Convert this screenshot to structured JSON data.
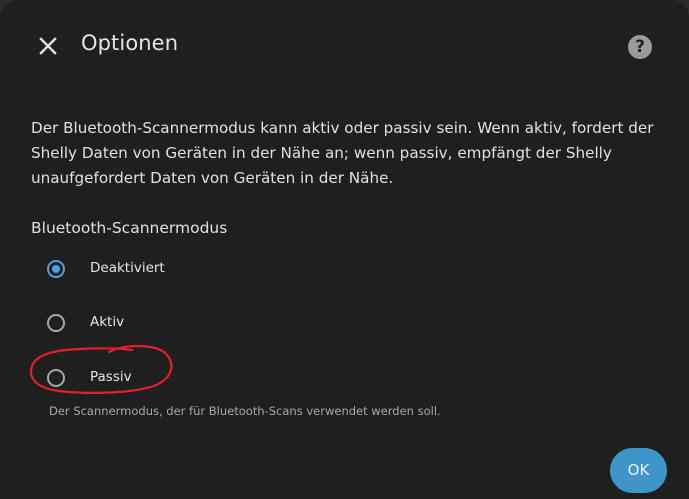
{
  "dialog": {
    "title": "Optionen",
    "close_icon": "close-icon",
    "help_icon": "help-icon",
    "help_glyph": "?"
  },
  "description": "Der Bluetooth-Scannermodus kann aktiv oder passiv sein. Wenn aktiv, fordert der Shelly Daten von Geräten in der Nähe an; wenn passiv, empfängt der Shelly unaufgefordert Daten von Geräten in der Nähe.",
  "scanner_mode": {
    "label": "Bluetooth-Scannermodus",
    "selected": "Deaktiviert",
    "options": [
      {
        "label": "Deaktiviert",
        "checked": true
      },
      {
        "label": "Aktiv",
        "checked": false
      },
      {
        "label": "Passiv",
        "checked": false
      }
    ],
    "helper": "Der Scannermodus, der für Bluetooth-Scans verwendet werden soll."
  },
  "actions": {
    "ok_label": "OK"
  },
  "colors": {
    "accent": "#4fa3e0",
    "ok_button": "#3f95c9",
    "annotation": "#e0202a",
    "dialog_bg": "#1f1f1f"
  }
}
